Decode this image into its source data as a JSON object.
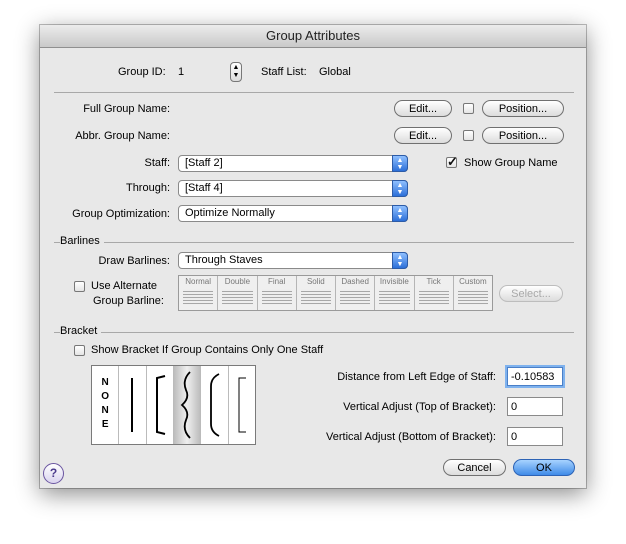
{
  "window": {
    "title": "Group Attributes"
  },
  "group": {
    "id_label": "Group ID:",
    "id_value": "1",
    "staff_list_label": "Staff List:",
    "staff_list_value": "Global"
  },
  "names": {
    "full_label": "Full Group Name:",
    "abbr_label": "Abbr. Group Name:",
    "edit_label": "Edit...",
    "position_label": "Position..."
  },
  "staff": {
    "staff_label": "Staff:",
    "staff_value": "[Staff 2]",
    "through_label": "Through:",
    "through_value": "[Staff 4]",
    "optimization_label": "Group Optimization:",
    "optimization_value": "Optimize Normally",
    "show_group_name_label": "Show Group Name"
  },
  "barlines": {
    "section_label": "Barlines",
    "draw_label": "Draw Barlines:",
    "draw_value": "Through Staves",
    "use_alt_label_1": "Use Alternate",
    "use_alt_label_2": "Group Barline:",
    "styles": [
      "Normal",
      "Double",
      "Final",
      "Solid",
      "Dashed",
      "Invisible",
      "Tick",
      "Custom"
    ],
    "select_label": "Select..."
  },
  "bracket": {
    "section_label": "Bracket",
    "show_if_one_label": "Show Bracket If Group Contains Only One Staff",
    "none_text": "NONE",
    "distance_label": "Distance from Left Edge of Staff:",
    "distance_value": "-0.10583",
    "top_label": "Vertical Adjust (Top of Bracket):",
    "top_value": "0",
    "bottom_label": "Vertical Adjust (Bottom of Bracket):",
    "bottom_value": "0"
  },
  "footer": {
    "cancel_label": "Cancel",
    "ok_label": "OK",
    "help_icon": "?"
  },
  "colors": {
    "accent": "#3f8be8",
    "window_bg": "#e8e8e8"
  }
}
